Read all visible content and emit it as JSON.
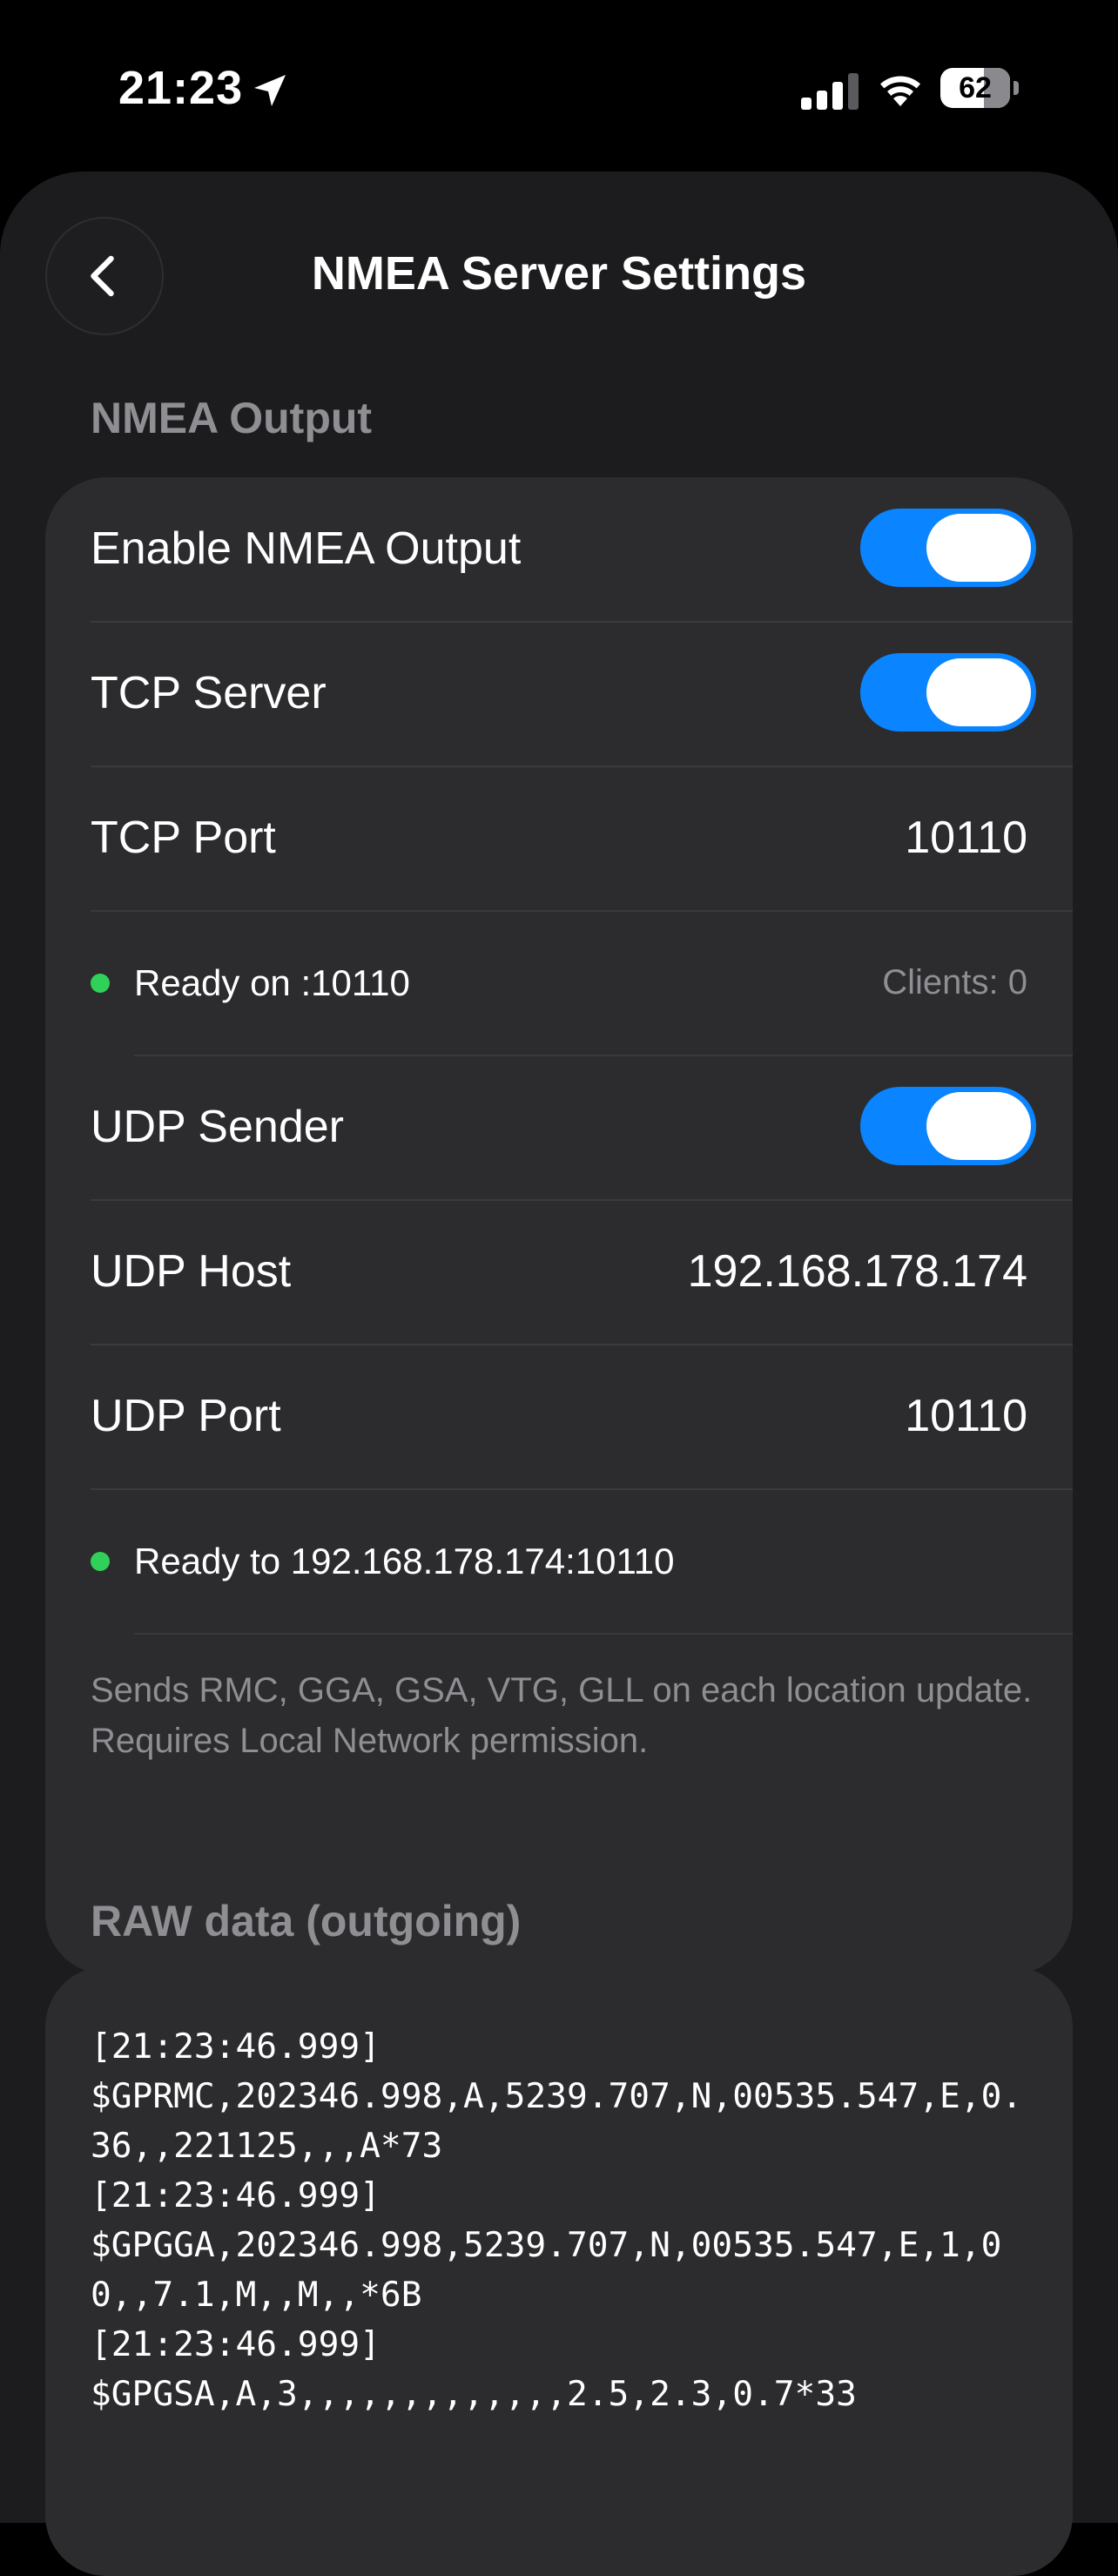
{
  "status_bar": {
    "time": "21:23",
    "battery_level": "62",
    "battery_fraction": 0.62,
    "icons": [
      "location-arrow-icon",
      "cellular-signal-icon",
      "wifi-icon",
      "battery-icon"
    ]
  },
  "nav": {
    "title": "NMEA Server Settings",
    "back_icon": "chevron-left-icon"
  },
  "nmea_output": {
    "header": "NMEA Output",
    "enable_label": "Enable NMEA Output",
    "enable_on": true,
    "tcp_server_label": "TCP Server",
    "tcp_server_on": true,
    "tcp_port_label": "TCP Port",
    "tcp_port_value": "10110",
    "tcp_status": "Ready on :10110",
    "tcp_clients": "Clients: 0",
    "udp_sender_label": "UDP Sender",
    "udp_sender_on": true,
    "udp_host_label": "UDP Host",
    "udp_host_value": "192.168.178.174",
    "udp_port_label": "UDP Port",
    "udp_port_value": "10110",
    "udp_status": "Ready to 192.168.178.174:10110",
    "footnote": "Sends RMC, GGA, GSA, VTG, GLL on each location update. Requires Local Network permission."
  },
  "raw_data": {
    "header": "RAW data (outgoing)",
    "log": "[21:23:46.999]\n$GPRMC,202346.998,A,5239.707,N,00535.547,E,0.36,,221125,,,A*73\n[21:23:46.999]\n$GPGGA,202346.998,5239.707,N,00535.547,E,1,00,,7.1,M,,M,,*6B\n[21:23:46.999]\n$GPGSA,A,3,,,,,,,,,,,,,2.5,2.3,0.7*33"
  },
  "colors": {
    "background": "#000000",
    "sheet": "#1c1c1e",
    "card": "#2c2c2e",
    "toggle_on": "#0a84ff",
    "status_ok": "#30d158",
    "secondary_text": "#8e8e93"
  }
}
